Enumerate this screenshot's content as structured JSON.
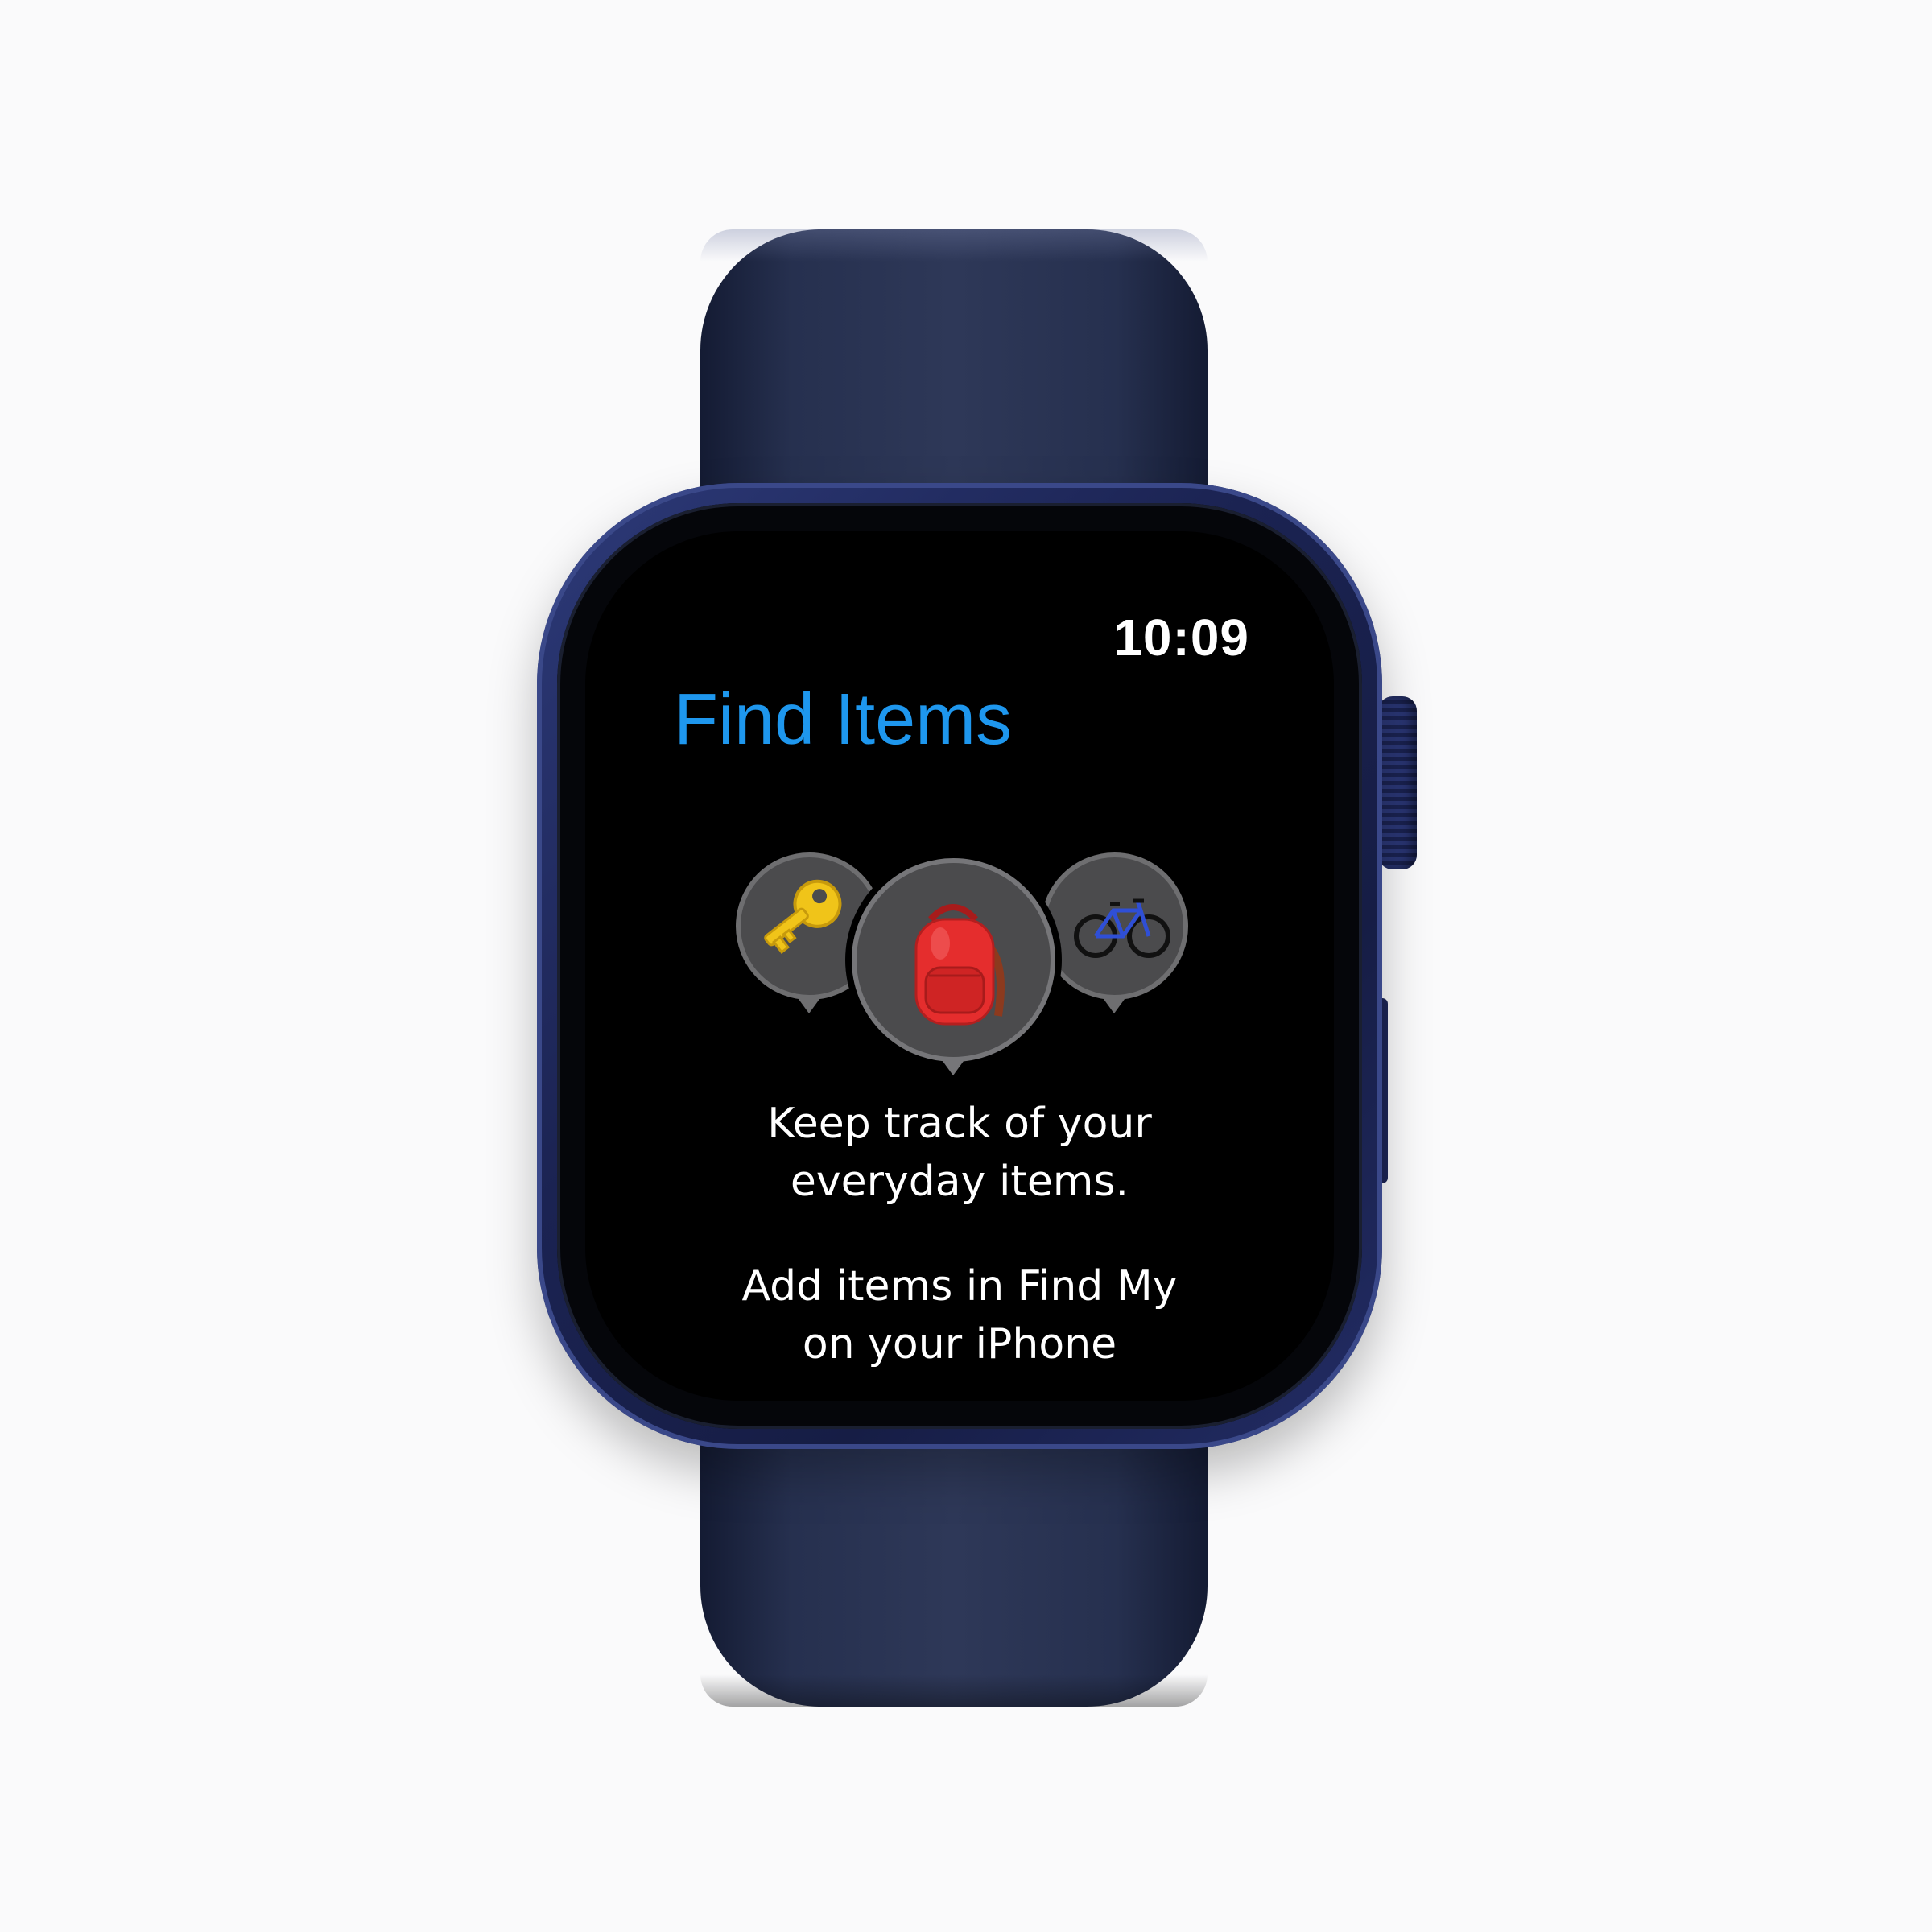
{
  "status": {
    "time": "10:09"
  },
  "app": {
    "title": "Find Items"
  },
  "items": [
    {
      "name": "keys",
      "icon": "key-icon"
    },
    {
      "name": "backpack",
      "icon": "backpack-icon"
    },
    {
      "name": "bicycle",
      "icon": "bicycle-icon"
    }
  ],
  "message": {
    "line1": "Keep track of your",
    "line2": "everyday items.",
    "line3": "Add items in Find My",
    "line4": "on your iPhone"
  },
  "colors": {
    "accent": "#1e97ee",
    "band": "#26304f",
    "case": "#1b2352",
    "screen": "#000000"
  }
}
